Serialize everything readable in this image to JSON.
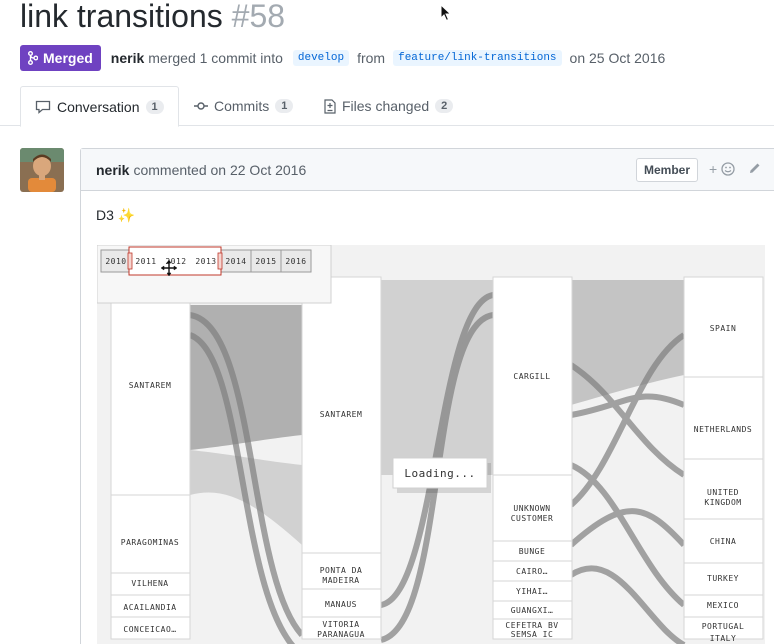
{
  "pr": {
    "title": "link transitions",
    "number": "#58",
    "status": "Merged",
    "author": "nerik",
    "merge_text": "merged 1 commit into",
    "base_branch": "develop",
    "from_text": "from",
    "head_branch": "feature/link-transitions",
    "date_text": "on 25 Oct 2016"
  },
  "tabs": [
    {
      "label": "Conversation",
      "count": "1"
    },
    {
      "label": "Commits",
      "count": "1"
    },
    {
      "label": "Files changed",
      "count": "2"
    }
  ],
  "comment": {
    "author": "nerik",
    "date_text": "commented on 22 Oct 2016",
    "role_badge": "Member",
    "reaction_label": "+",
    "body": "D3",
    "body_emoji": "✨"
  },
  "viz": {
    "years": [
      "2010",
      "2011",
      "2012",
      "2013",
      "2014",
      "2015",
      "2016"
    ],
    "loading": "Loading...",
    "col1": [
      "SANTAREM",
      "PARAGOMINAS",
      "VILHENA",
      "ACAILANDIA",
      "CONCEICAO…"
    ],
    "col2": [
      "SANTAREM",
      "PONTA DA",
      "MADEIRA",
      "MANAUS",
      "VITORIA",
      "PARANAGUA"
    ],
    "col3": [
      "CARGILL",
      "UNKNOWN",
      "CUSTOMER",
      "BUNGE",
      "CAIRO…",
      "YIHAI…",
      "GUANGXI…",
      "CEFETRA BV",
      "SEMSA IC"
    ],
    "col4": [
      "SPAIN",
      "NETHERLANDS",
      "UNITED",
      "KINGDOM",
      "CHINA",
      "TURKEY",
      "MEXICO",
      "PORTUGAL",
      "ITALY"
    ]
  },
  "colors": {
    "merged": "#6f42c1",
    "branch_bg": "#eaf5ff",
    "branch_fg": "#0366d6",
    "flow": "#9a9a9a"
  },
  "icons": [
    "git-merge-icon",
    "comment-icon",
    "commit-icon",
    "file-diff-icon",
    "smiley-icon",
    "pencil-icon",
    "mouse-cursor-icon",
    "move-cursor-icon"
  ]
}
